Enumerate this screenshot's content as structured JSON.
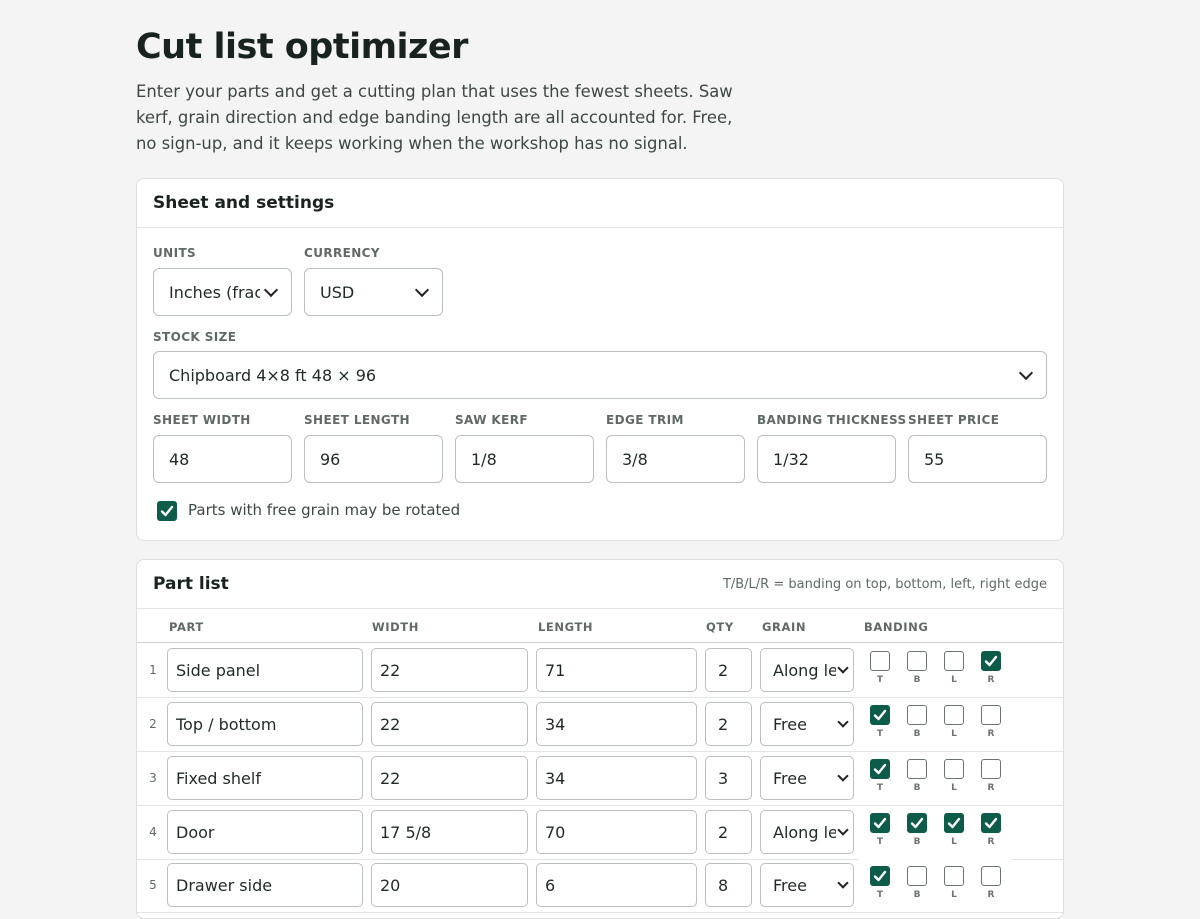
{
  "page": {
    "title": "Cut list optimizer",
    "intro": "Enter your parts and get a cutting plan that uses the fewest sheets. Saw kerf, grain direction and edge banding length are all accounted for. Free, no sign-up, and it keeps working when the workshop has no signal."
  },
  "settings": {
    "title": "Sheet and settings",
    "units_label": "UNITS",
    "units_value": "Inches (fractions)",
    "currency_label": "CURRENCY",
    "currency_value": "USD",
    "stock_label": "STOCK SIZE",
    "stock_value": "Chipboard 4×8 ft 48 × 96",
    "sheet_width_label": "SHEET WIDTH",
    "sheet_width_value": "48",
    "sheet_length_label": "SHEET LENGTH",
    "sheet_length_value": "96",
    "saw_kerf_label": "SAW KERF",
    "saw_kerf_value": "1/8",
    "edge_trim_label": "EDGE TRIM",
    "edge_trim_value": "3/8",
    "banding_thickness_label": "BANDING THICKNESS",
    "banding_thickness_value": "1/32",
    "sheet_price_label": "SHEET PRICE",
    "sheet_price_value": "55",
    "rotate_label": "Parts with free grain may be rotated",
    "rotate_checked": true
  },
  "parts": {
    "title": "Part list",
    "note": "T/B/L/R = banding on top, bottom, left, right edge",
    "columns": {
      "part": "PART",
      "width": "WIDTH",
      "length": "LENGTH",
      "qty": "QTY",
      "grain": "GRAIN",
      "banding": "BANDING"
    },
    "edge_labels": [
      "T",
      "B",
      "L",
      "R"
    ],
    "rows": [
      {
        "num": "1",
        "name": "Side panel",
        "width": "22",
        "length": "71",
        "qty": "2",
        "grain": "Along length",
        "banding": [
          false,
          false,
          false,
          true
        ]
      },
      {
        "num": "2",
        "name": "Top / bottom",
        "width": "22",
        "length": "34",
        "qty": "2",
        "grain": "Free",
        "banding": [
          true,
          false,
          false,
          false
        ]
      },
      {
        "num": "3",
        "name": "Fixed shelf",
        "width": "22",
        "length": "34",
        "qty": "3",
        "grain": "Free",
        "banding": [
          true,
          false,
          false,
          false
        ]
      },
      {
        "num": "4",
        "name": "Door",
        "width": "17 5/8",
        "length": "70",
        "qty": "2",
        "grain": "Along length",
        "banding": [
          true,
          true,
          true,
          true
        ]
      },
      {
        "num": "5",
        "name": "Drawer side",
        "width": "20",
        "length": "6",
        "qty": "8",
        "grain": "Free",
        "banding": [
          true,
          false,
          false,
          false
        ]
      }
    ]
  },
  "colors": {
    "accent": "#0d5c4a",
    "background": "#f3f4f3"
  }
}
